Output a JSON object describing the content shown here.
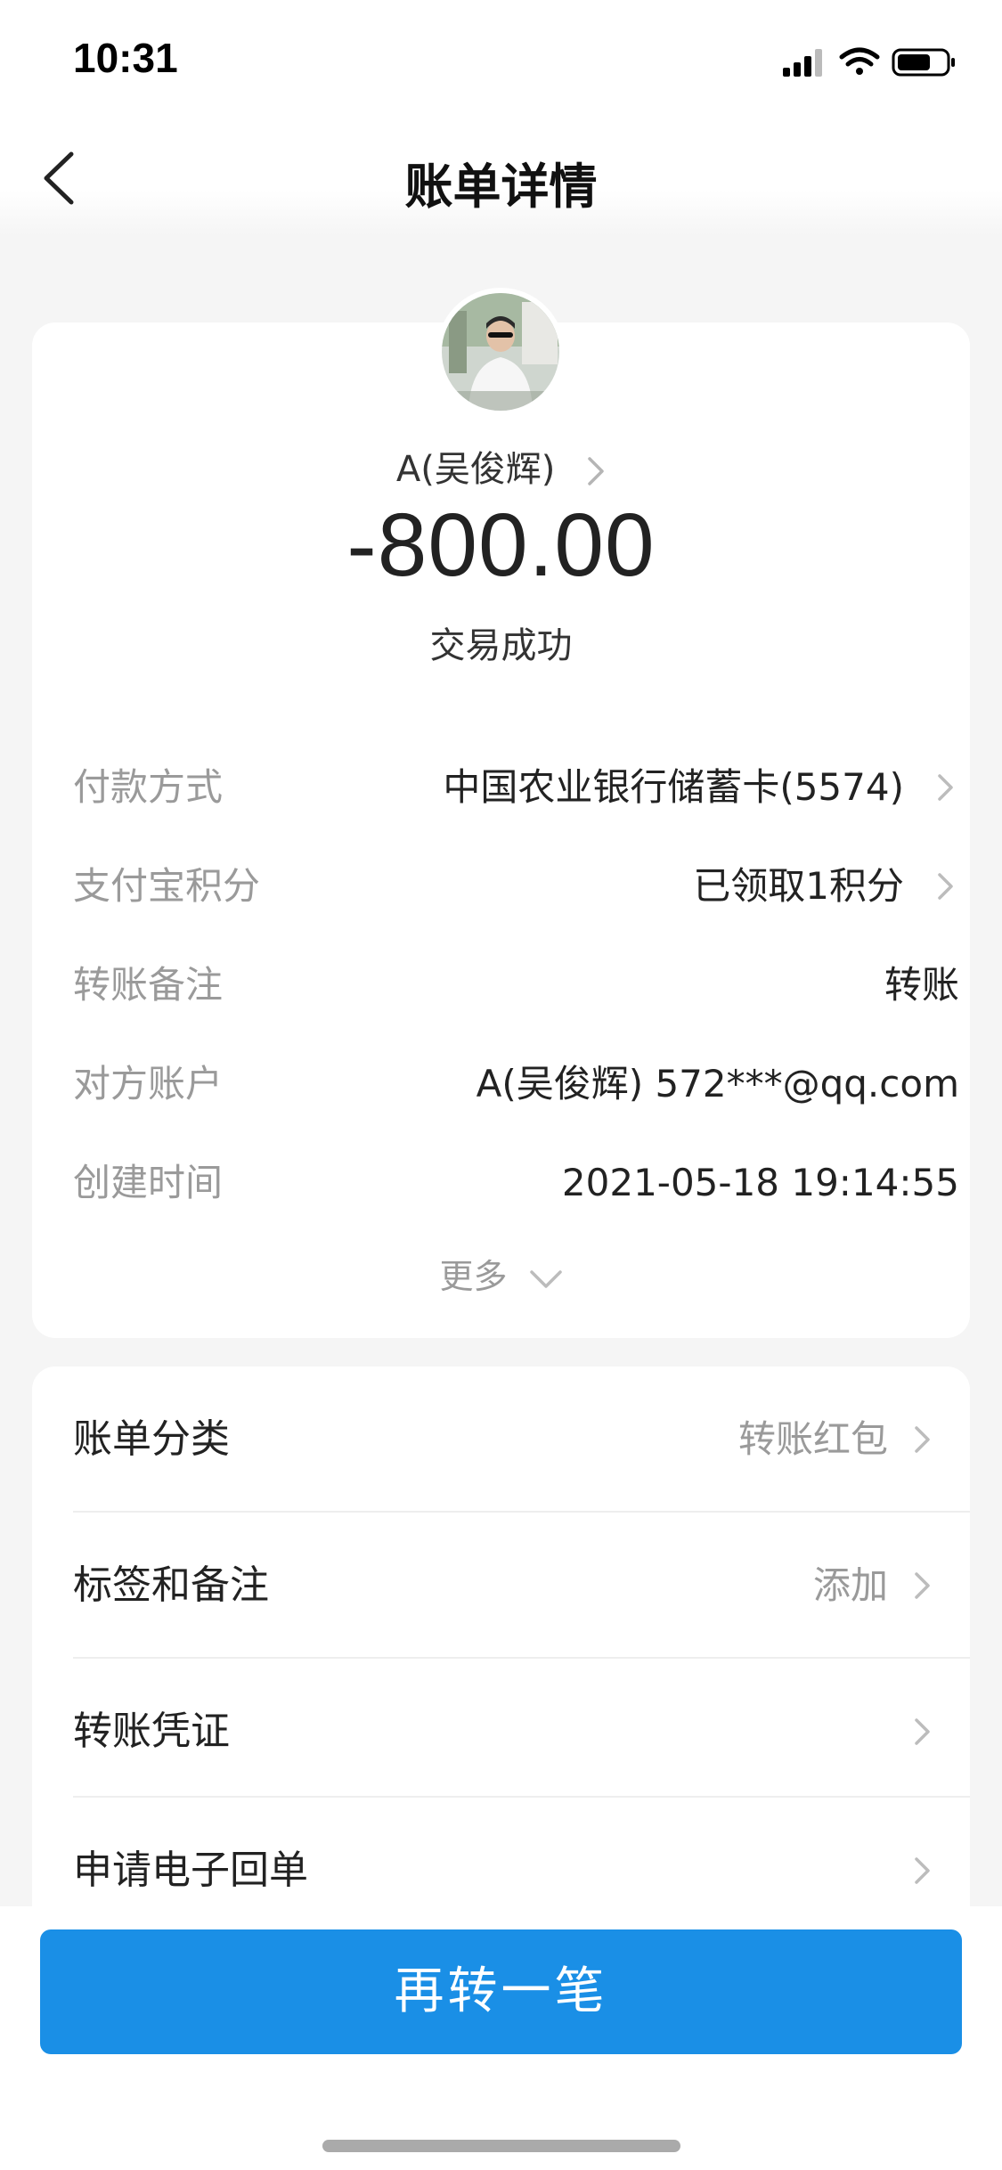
{
  "status_bar": {
    "time": "10:31"
  },
  "header": {
    "title": "账单详情"
  },
  "summary": {
    "counterparty": "A(吴俊辉)",
    "amount": "-800.00",
    "status": "交易成功"
  },
  "details": [
    {
      "label": "付款方式",
      "value": "中国农业银行储蓄卡(5574)",
      "chevron": true
    },
    {
      "label": "支付宝积分",
      "value": "已领取1积分",
      "chevron": true
    },
    {
      "label": "转账备注",
      "value": "转账",
      "chevron": false
    },
    {
      "label": "对方账户",
      "value": "A(吴俊辉) 572***@qq.com",
      "chevron": false
    },
    {
      "label": "创建时间",
      "value": "2021-05-18 19:14:55",
      "chevron": false
    }
  ],
  "more_label": "更多",
  "actions": [
    {
      "label": "账单分类",
      "value": "转账红包"
    },
    {
      "label": "标签和备注",
      "value": "添加"
    },
    {
      "label": "转账凭证",
      "value": ""
    },
    {
      "label": "申请电子回单",
      "value": ""
    }
  ],
  "footer": {
    "button": "再转一笔"
  },
  "colors": {
    "accent": "#1a8fe6",
    "background": "#f5f5f5",
    "muted_text": "#9a9a9a"
  }
}
